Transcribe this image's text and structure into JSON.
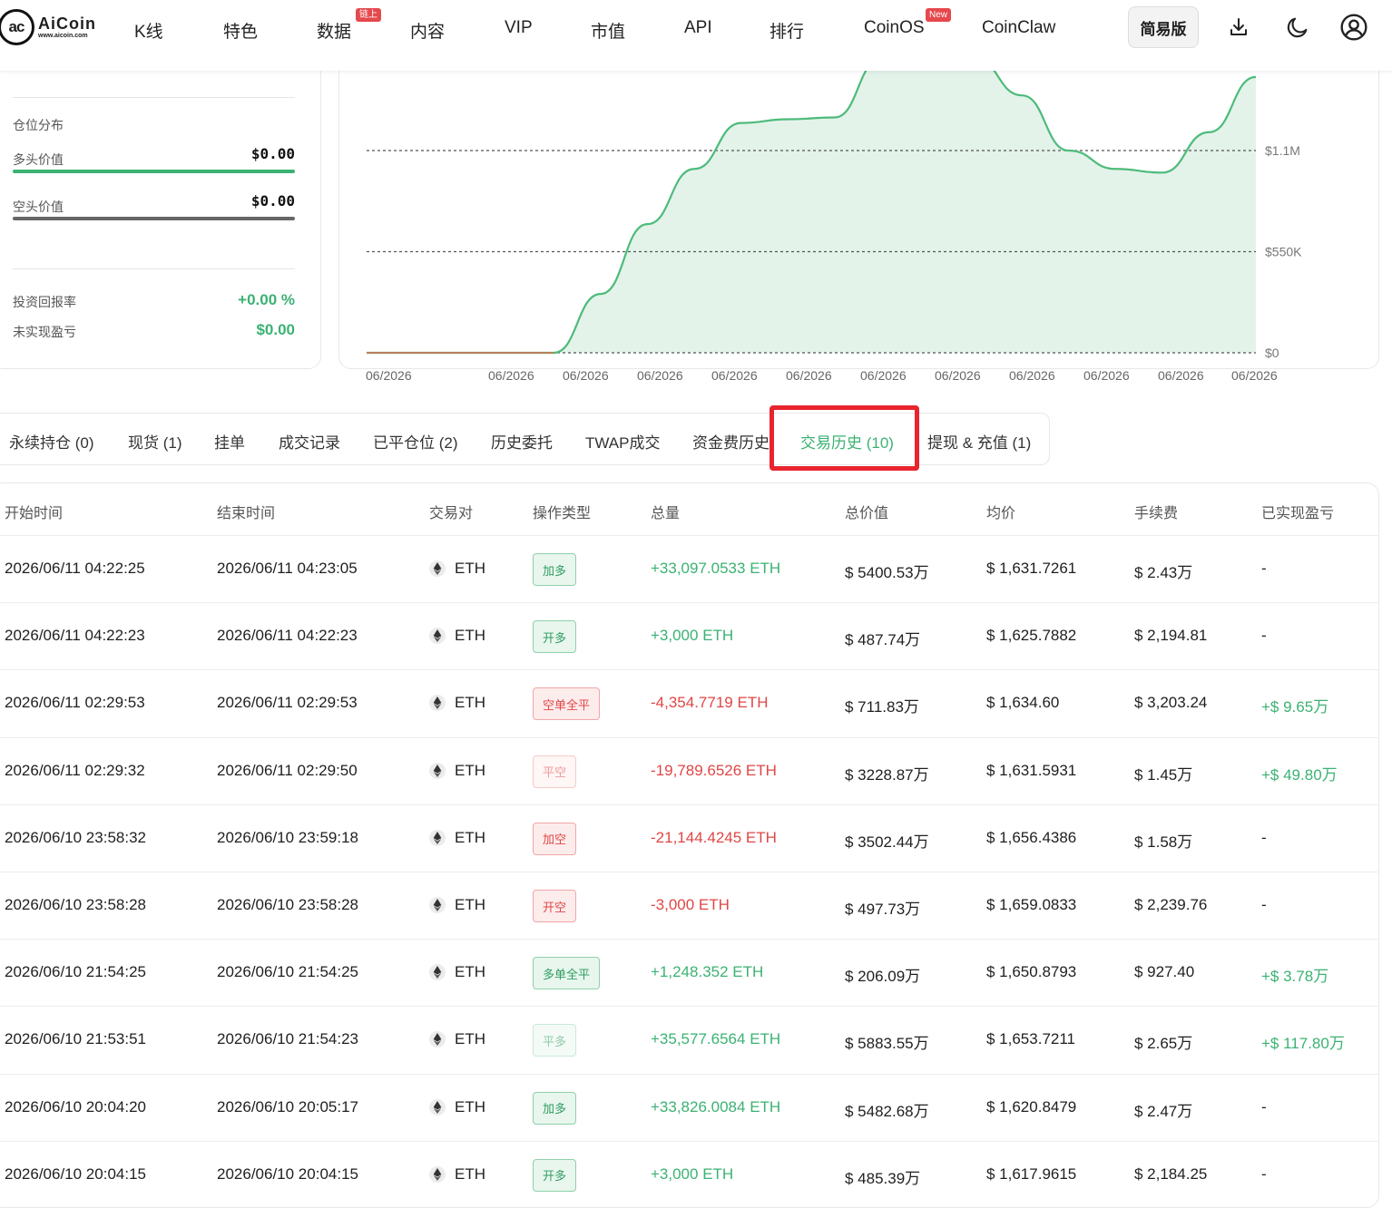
{
  "nav": {
    "logo_name": "AiCoin",
    "logo_url": "www.aicoin.com",
    "logo_mark": "ac",
    "items": [
      "K线",
      "特色",
      "数据",
      "内容",
      "VIP",
      "市值",
      "API",
      "排行",
      "CoinOS",
      "CoinClaw"
    ],
    "badge_data": "链上",
    "badge_coinos": "New",
    "simple_label": "简易版",
    "icons": [
      "download-icon",
      "moon-icon",
      "user-icon"
    ]
  },
  "position": {
    "section_label": "仓位分布",
    "long_label": "多头价值",
    "long_value": "$0.00",
    "short_label": "空头价值",
    "short_value": "$0.00",
    "roi_label": "投资回报率",
    "roi_value": "+0.00 %",
    "pnl_label": "未实现盈亏",
    "pnl_value": "$0.00",
    "colors": {
      "long": "#3bb273",
      "short": "#666666"
    }
  },
  "chart_data": {
    "type": "area",
    "y_ticks": [
      "$1.1M",
      "$550K",
      "$0"
    ],
    "x_ticks": [
      "06/2026",
      "06/2026",
      "06/2026",
      "06/2026",
      "06/2026",
      "06/2026",
      "06/2026",
      "06/2026",
      "06/2026",
      "06/2026",
      "06/2026",
      "06/2026"
    ],
    "ylim": [
      0,
      1100000
    ],
    "points": [
      [
        0,
        0
      ],
      [
        1,
        0
      ],
      [
        2,
        0
      ],
      [
        3,
        0
      ],
      [
        4,
        0
      ],
      [
        5,
        320000
      ],
      [
        6,
        700000
      ],
      [
        7,
        1000000
      ],
      [
        8,
        1250000
      ],
      [
        9,
        1270000
      ],
      [
        10,
        1280000
      ],
      [
        11,
        1600000
      ],
      [
        12,
        1650000
      ],
      [
        13,
        1600000
      ],
      [
        14,
        1400000
      ],
      [
        15,
        1100000
      ],
      [
        16,
        1000000
      ],
      [
        17,
        980000
      ],
      [
        18,
        1200000
      ],
      [
        19,
        1500000
      ]
    ],
    "colors": {
      "line": "#4dbb7a",
      "fill": "#e3f3ea",
      "grid": "#555555",
      "zero": "#b5815a"
    }
  },
  "tabs": [
    {
      "label": "永续持仓 (0)",
      "active": false
    },
    {
      "label": "现货 (1)",
      "active": false
    },
    {
      "label": "挂单",
      "active": false
    },
    {
      "label": "成交记录",
      "active": false
    },
    {
      "label": "已平仓位 (2)",
      "active": false
    },
    {
      "label": "历史委托",
      "active": false
    },
    {
      "label": "TWAP成交",
      "active": false
    },
    {
      "label": "资金费历史",
      "active": false
    },
    {
      "label": "交易历史 (10)",
      "active": true
    },
    {
      "label": "提现 & 充值 (1)",
      "active": false
    }
  ],
  "table": {
    "headers": [
      "开始时间",
      "结束时间",
      "交易对",
      "操作类型",
      "总量",
      "总价值",
      "均价",
      "手续费",
      "已实现盈亏"
    ],
    "rows": [
      {
        "start": "2026/06/11 04:22:25",
        "end": "2026/06/11 04:23:05",
        "pair": "ETH",
        "op": "加多",
        "op_style": "green",
        "qty": "+33,097.0533 ETH",
        "qty_dir": "green",
        "value": "$ 5400.53万",
        "avg": "$ 1,631.7261",
        "fee": "$ 2.43万",
        "pnl": "-"
      },
      {
        "start": "2026/06/11 04:22:23",
        "end": "2026/06/11 04:22:23",
        "pair": "ETH",
        "op": "开多",
        "op_style": "green",
        "qty": "+3,000 ETH",
        "qty_dir": "green",
        "value": "$ 487.74万",
        "avg": "$ 1,625.7882",
        "fee": "$ 2,194.81",
        "pnl": "-"
      },
      {
        "start": "2026/06/11 02:29:53",
        "end": "2026/06/11 02:29:53",
        "pair": "ETH",
        "op": "空单全平",
        "op_style": "red",
        "qty": "-4,354.7719 ETH",
        "qty_dir": "red",
        "value": "$ 711.83万",
        "avg": "$ 1,634.60",
        "fee": "$ 3,203.24",
        "pnl": "+$ 9.65万"
      },
      {
        "start": "2026/06/11 02:29:32",
        "end": "2026/06/11 02:29:50",
        "pair": "ETH",
        "op": "平空",
        "op_style": "red-light",
        "qty": "-19,789.6526 ETH",
        "qty_dir": "red",
        "value": "$ 3228.87万",
        "avg": "$ 1,631.5931",
        "fee": "$ 1.45万",
        "pnl": "+$ 49.80万"
      },
      {
        "start": "2026/06/10 23:58:32",
        "end": "2026/06/10 23:59:18",
        "pair": "ETH",
        "op": "加空",
        "op_style": "red",
        "qty": "-21,144.4245 ETH",
        "qty_dir": "red",
        "value": "$ 3502.44万",
        "avg": "$ 1,656.4386",
        "fee": "$ 1.58万",
        "pnl": "-"
      },
      {
        "start": "2026/06/10 23:58:28",
        "end": "2026/06/10 23:58:28",
        "pair": "ETH",
        "op": "开空",
        "op_style": "red",
        "qty": "-3,000 ETH",
        "qty_dir": "red",
        "value": "$ 497.73万",
        "avg": "$ 1,659.0833",
        "fee": "$ 2,239.76",
        "pnl": "-"
      },
      {
        "start": "2026/06/10 21:54:25",
        "end": "2026/06/10 21:54:25",
        "pair": "ETH",
        "op": "多单全平",
        "op_style": "green",
        "qty": "+1,248.352 ETH",
        "qty_dir": "green",
        "value": "$ 206.09万",
        "avg": "$ 1,650.8793",
        "fee": "$ 927.40",
        "pnl": "+$ 3.78万"
      },
      {
        "start": "2026/06/10 21:53:51",
        "end": "2026/06/10 21:54:23",
        "pair": "ETH",
        "op": "平多",
        "op_style": "green-light",
        "qty": "+35,577.6564 ETH",
        "qty_dir": "green",
        "value": "$ 5883.55万",
        "avg": "$ 1,653.7211",
        "fee": "$ 2.65万",
        "pnl": "+$ 117.80万"
      },
      {
        "start": "2026/06/10 20:04:20",
        "end": "2026/06/10 20:05:17",
        "pair": "ETH",
        "op": "加多",
        "op_style": "green",
        "qty": "+33,826.0084 ETH",
        "qty_dir": "green",
        "value": "$ 5482.68万",
        "avg": "$ 1,620.8479",
        "fee": "$ 2.47万",
        "pnl": "-"
      },
      {
        "start": "2026/06/10 20:04:15",
        "end": "2026/06/10 20:04:15",
        "pair": "ETH",
        "op": "开多",
        "op_style": "green",
        "qty": "+3,000 ETH",
        "qty_dir": "green",
        "value": "$ 485.39万",
        "avg": "$ 1,617.9615",
        "fee": "$ 2,184.25",
        "pnl": "-"
      }
    ]
  }
}
